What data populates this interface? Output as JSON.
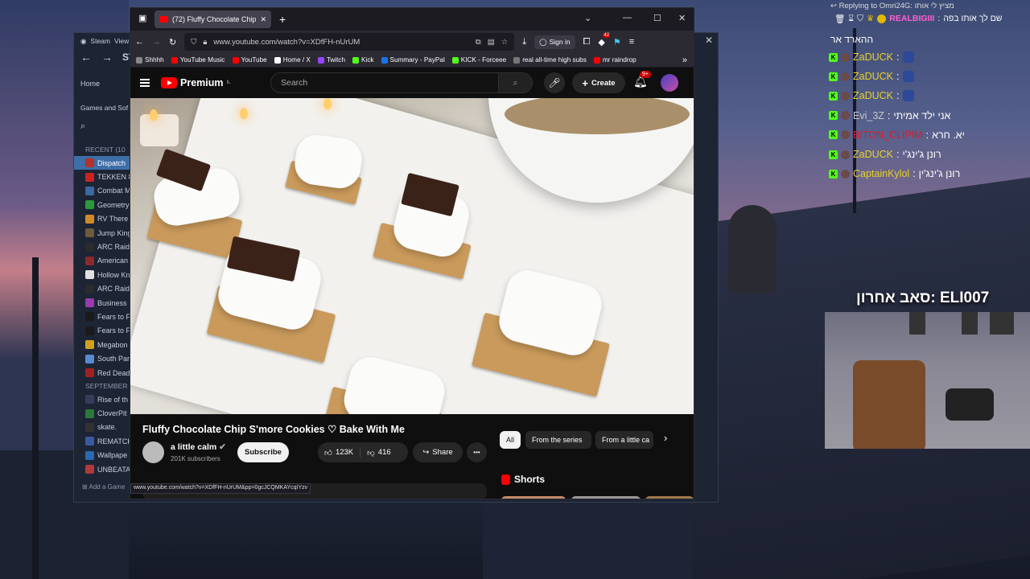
{
  "steam": {
    "title": "Steam",
    "menu": "View",
    "store": "STO",
    "home": "Home",
    "games_and_software": "Games and Sof",
    "recent_header": "RECENT",
    "recent_count": "(10",
    "september_header": "SEPTEMBER",
    "add_game": "Add a Game",
    "games": [
      {
        "name": "Dispatch",
        "color": "#b3332b"
      },
      {
        "name": "TEKKEN 8",
        "color": "#c22"
      },
      {
        "name": "Combat M",
        "color": "#3a6aa0"
      },
      {
        "name": "Geometry",
        "color": "#2a9a3a"
      },
      {
        "name": "RV There",
        "color": "#d08a28"
      },
      {
        "name": "Jump King",
        "color": "#6f5a3a"
      },
      {
        "name": "ARC Raide",
        "color": "#2b2b2b"
      },
      {
        "name": "American",
        "color": "#8a2a2a"
      },
      {
        "name": "Hollow Kn",
        "color": "#e0e0e0"
      },
      {
        "name": "ARC Raide",
        "color": "#2b2b2b"
      },
      {
        "name": "Business",
        "color": "#9a3ab0"
      },
      {
        "name": "Fears to F",
        "color": "#1a1a1a"
      },
      {
        "name": "Fears to F",
        "color": "#1a1a1a"
      },
      {
        "name": "Megabon",
        "color": "#d0a020"
      },
      {
        "name": "South Par",
        "color": "#5a8ad0"
      },
      {
        "name": "Red Dead",
        "color": "#a02020"
      }
    ],
    "september_games": [
      {
        "name": "Rise of th",
        "color": "#3a3a5a"
      },
      {
        "name": "CloverPit",
        "color": "#2a7a3a"
      },
      {
        "name": "skate.",
        "color": "#333"
      },
      {
        "name": "REMATCH",
        "color": "#3a5aa0"
      },
      {
        "name": "Wallpape",
        "color": "#2a6ab0"
      },
      {
        "name": "UNBEATA",
        "color": "#b03a3a"
      }
    ]
  },
  "browser": {
    "tab_title": "(72) Fluffy Chocolate Chip S'mo",
    "url": "www.youtube.com/watch?v=XDfFH-nUrUM",
    "sign_in": "Sign in",
    "extension_badge": "42",
    "status_url": "www.youtube.com/watch?v=XDfFH-nUrUM&pp=0gcJCQMKAYcqIYzv",
    "bookmarks": [
      {
        "label": "Shhhh",
        "color": "#888"
      },
      {
        "label": "YouTube Music",
        "color": "#f00"
      },
      {
        "label": "YouTube",
        "color": "#f00"
      },
      {
        "label": "Home / X",
        "color": "#fff"
      },
      {
        "label": "Twitch",
        "color": "#9146ff"
      },
      {
        "label": "Kick",
        "color": "#53fc18"
      },
      {
        "label": "Summary - PayPal",
        "color": "#1a73e8"
      },
      {
        "label": "KICK - Forceee",
        "color": "#53fc18"
      },
      {
        "label": "real all-time high subs",
        "color": "#777"
      },
      {
        "label": "mr raindrop",
        "color": "#f00"
      }
    ]
  },
  "youtube": {
    "logo": "Premium",
    "region": "IL",
    "search_placeholder": "Search",
    "create": "Create",
    "notifications": "9+",
    "video_title": "Fluffy Chocolate Chip S'more Cookies ♡ Bake With Me",
    "channel": "a little calm",
    "subscribers": "201K subscribers",
    "subscribe": "Subscribe",
    "likes": "123K",
    "dislikes": "416",
    "share": "Share",
    "more": "•••",
    "chips": [
      "All",
      "From the series",
      "From a little ca"
    ],
    "shorts": "Shorts"
  },
  "chat": {
    "replying": "Replying to Omri24G: מציץ לי אותו",
    "reply_user": "REALBIGIII",
    "reply_text": "שם לך אותו בפה",
    "header_line": "ההארד אר",
    "messages": [
      {
        "user": "ZaDUCK",
        "text": "",
        "color": "#e8d12a"
      },
      {
        "user": "ZaDUCK",
        "text": "",
        "color": "#e8d12a"
      },
      {
        "user": "ZaDUCK",
        "text": "",
        "color": "#e8d12a"
      },
      {
        "user": "Evi_3Z",
        "text": "אני ילד אמיתי",
        "color": "#c9c9c9"
      },
      {
        "user": "BITON_CLIPIM",
        "text": "יא. חרא",
        "color": "#e01a2a"
      },
      {
        "user": "ZaDUCK",
        "text": "רונן ג'ינג'י",
        "color": "#e8d12a"
      },
      {
        "user": "CaptainKylol",
        "text": "רונן ג'ינג'ין",
        "color": "#e8d12a"
      }
    ],
    "last_sub": "סאב אחרון: ELI007"
  }
}
